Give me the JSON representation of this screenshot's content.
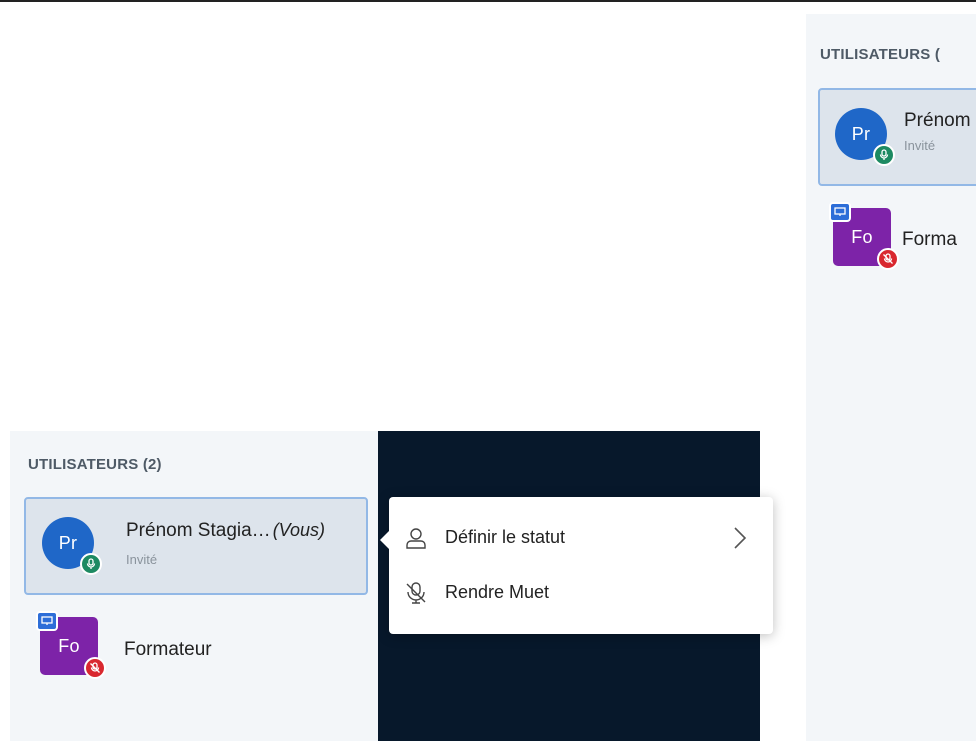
{
  "users_panel": {
    "title": "UTILISATEURS (2)",
    "users": [
      {
        "initials": "Pr",
        "name": "Prénom Stagia…",
        "you_label": "(Vous)",
        "role": "Invité",
        "avatar_color": "#1f67c8",
        "status": "microphone-on",
        "selected": true
      },
      {
        "initials": "Fo",
        "name": "Formateur",
        "avatar_color": "#7d23a8",
        "status": "microphone-muted",
        "presenter": true
      }
    ]
  },
  "right_panel": {
    "title": "UTILISATEURS (",
    "users": [
      {
        "initials": "Pr",
        "name": "Prénom",
        "role": "Invité"
      },
      {
        "initials": "Fo",
        "name": "Forma"
      }
    ]
  },
  "context_menu": {
    "items": [
      {
        "label": "Définir le statut",
        "icon": "user-icon",
        "has_submenu": true
      },
      {
        "label": "Rendre Muet",
        "icon": "mic-muted-icon"
      }
    ]
  },
  "colors": {
    "panel_bg": "#f3f6f9",
    "selected_bg": "#dde4ec",
    "selected_border": "#92b8e6",
    "dark_area": "#07182b",
    "mic_on": "#1d8a62",
    "mic_off": "#d9282f"
  }
}
